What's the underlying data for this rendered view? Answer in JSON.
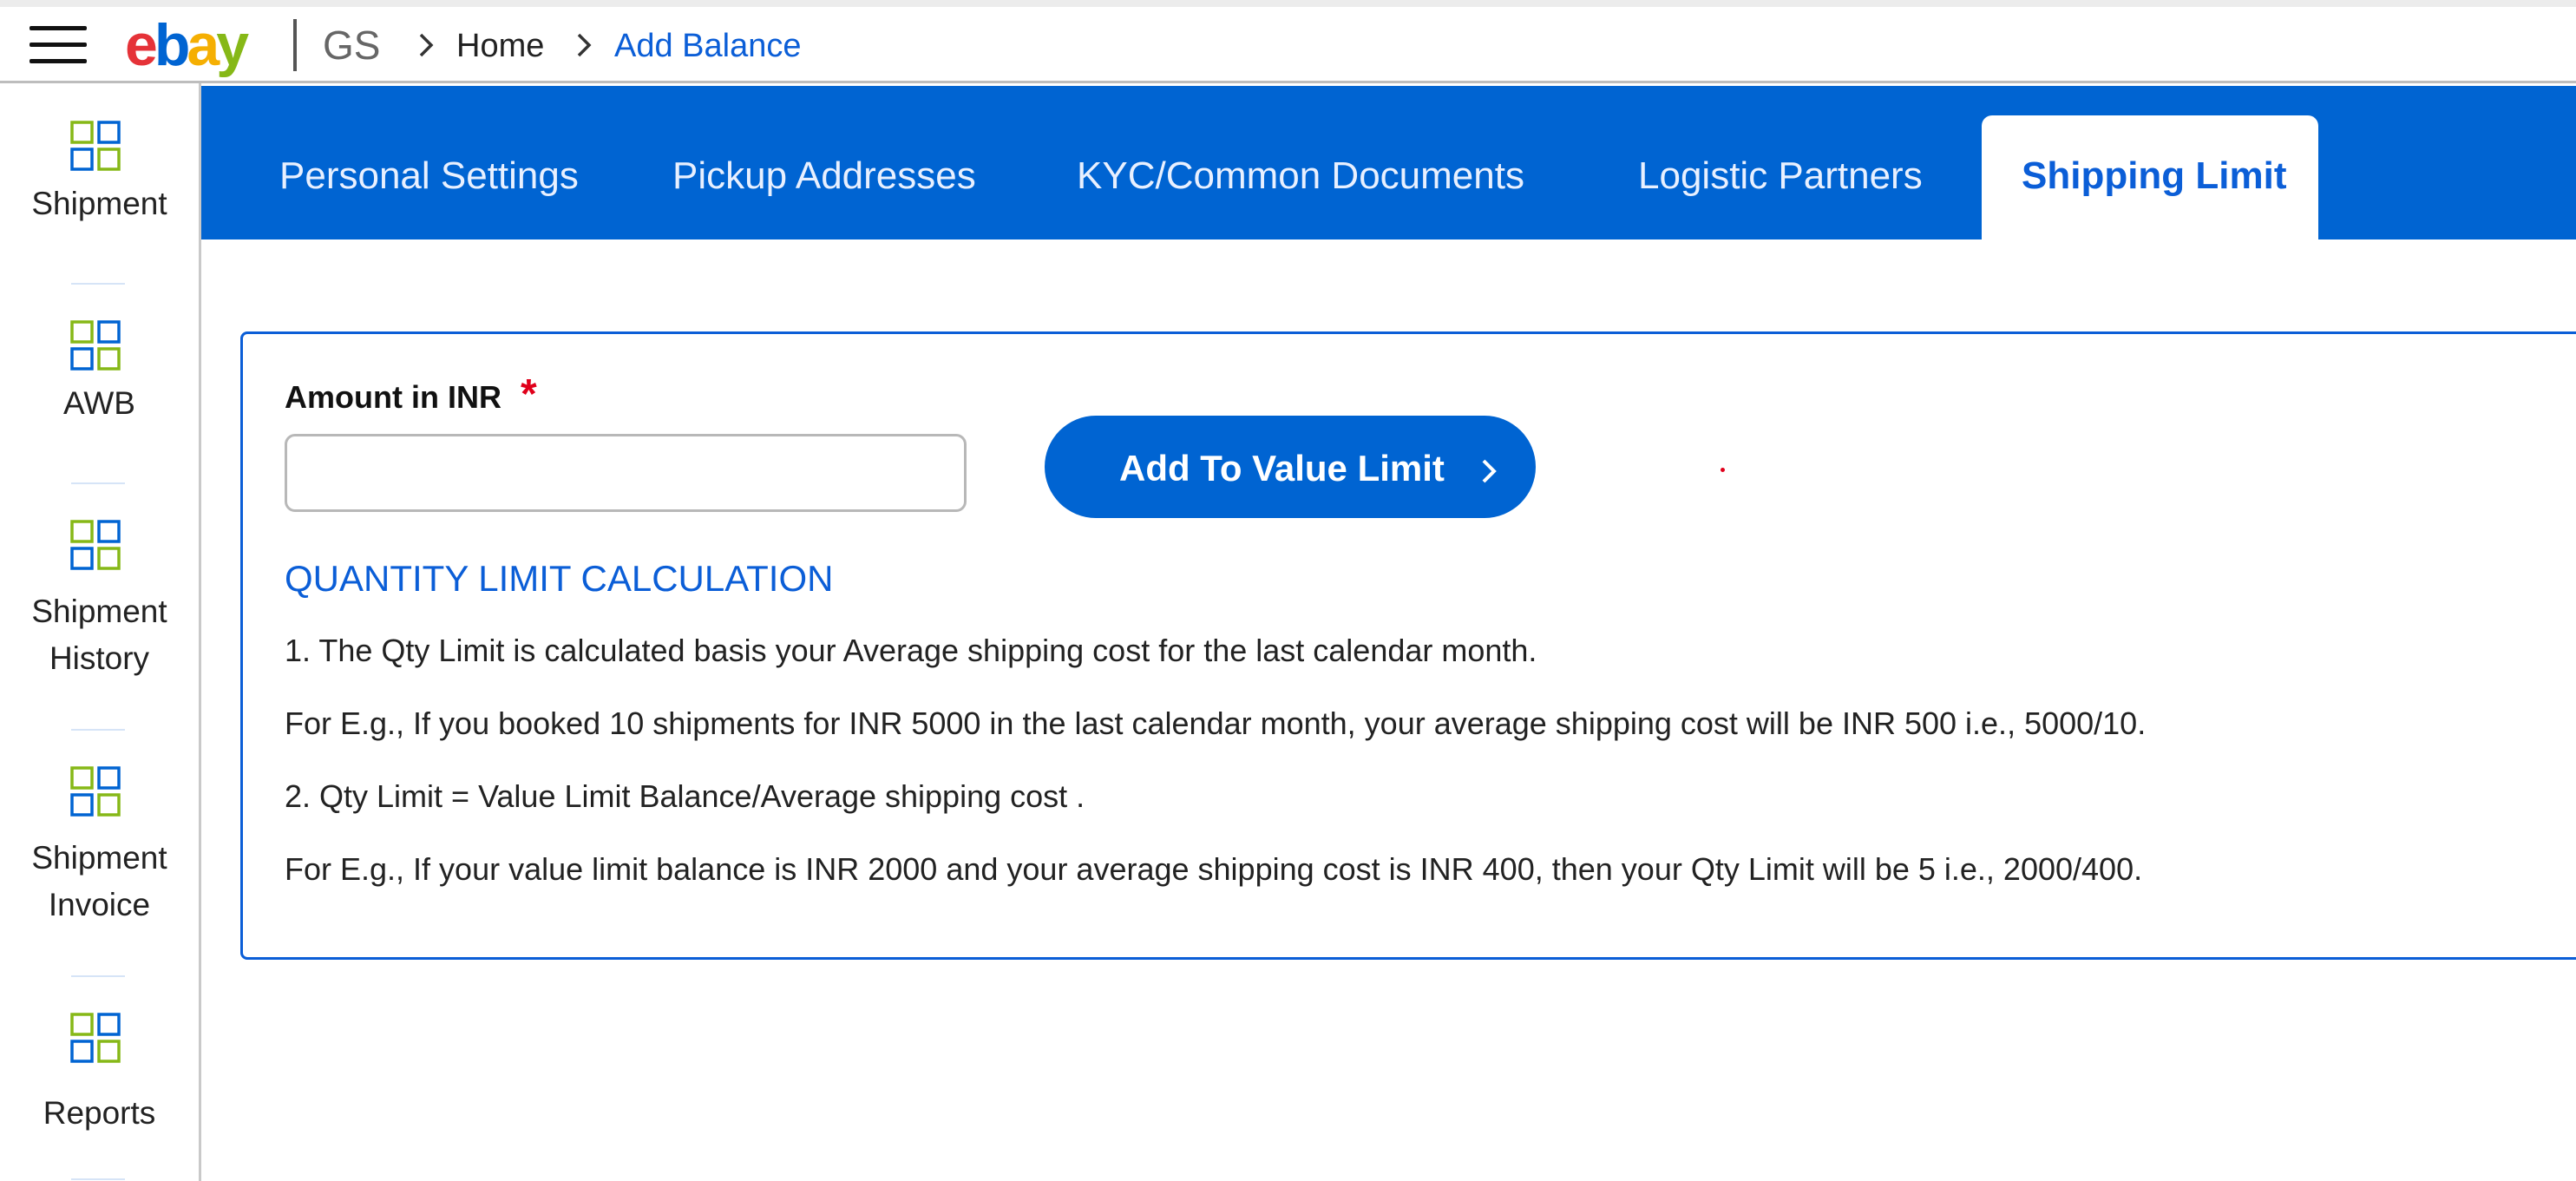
{
  "header": {
    "logo": {
      "e": "e",
      "b": "b",
      "a": "a",
      "y": "y"
    },
    "brand_sub": "GS",
    "breadcrumb": [
      "Home",
      "Add Balance"
    ]
  },
  "sidebar": {
    "items": [
      {
        "label_lines": [
          "Shipment"
        ],
        "icon": "grid-icon"
      },
      {
        "label_lines": [
          "AWB"
        ],
        "icon": "grid-icon"
      },
      {
        "label_lines": [
          "Shipment",
          "History"
        ],
        "icon": "grid-icon"
      },
      {
        "label_lines": [
          "Shipment",
          "Invoice"
        ],
        "icon": "grid-icon"
      },
      {
        "label_lines": [
          "Reports"
        ],
        "icon": "grid-icon"
      }
    ]
  },
  "tabs": [
    {
      "label": "Personal Settings",
      "active": false
    },
    {
      "label": "Pickup Addresses",
      "active": false
    },
    {
      "label": "KYC/Common Documents",
      "active": false
    },
    {
      "label": "Logistic Partners",
      "active": false
    },
    {
      "label": "Shipping Limit",
      "active": true
    }
  ],
  "form": {
    "amount_label": "Amount in INR",
    "required_mark": "*",
    "amount_value": "",
    "submit_label": "Add To Value Limit"
  },
  "info": {
    "title": "QUANTITY LIMIT CALCULATION",
    "lines": [
      "1. The Qty Limit is calculated basis your Average shipping cost for the last calendar month.",
      "For E.g., If you booked 10 shipments for INR 5000 in the last calendar month, your average shipping cost will be INR 500 i.e., 5000/10.",
      "2. Qty Limit = Value Limit Balance/Average shipping cost .",
      "For E.g., If your value limit balance is INR 2000 and your average shipping cost is INR 400, then your Qty Limit will be 5 i.e., 2000/400."
    ]
  },
  "colors": {
    "brand_blue": "#0064d2",
    "link_blue": "#0b5ed7",
    "required_red": "#e0001b",
    "icon_green": "#86b817"
  }
}
